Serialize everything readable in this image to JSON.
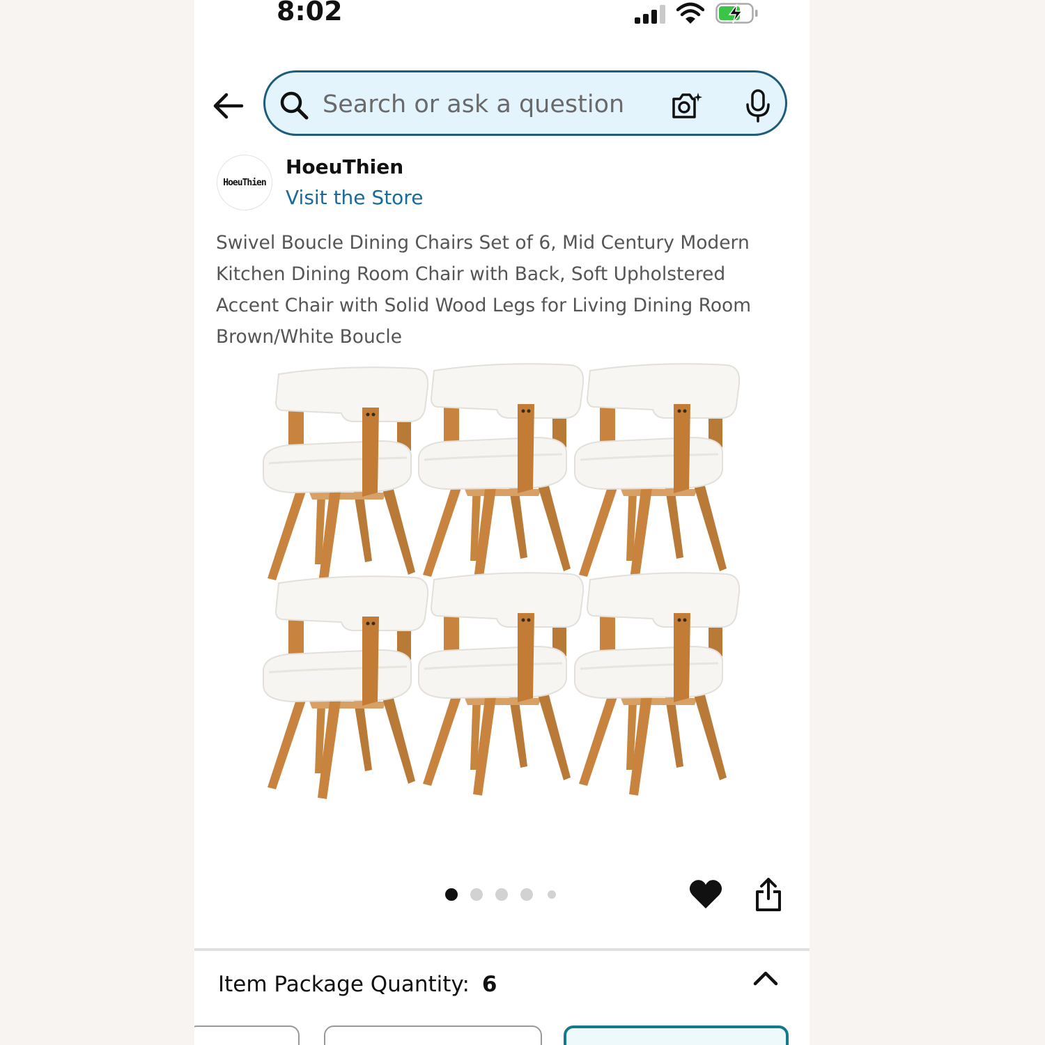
{
  "status_bar": {
    "time": "8:02"
  },
  "search": {
    "placeholder": "Search or ask a question"
  },
  "store": {
    "logo_text": "HoeuThien",
    "name": "HoeuThien",
    "link": "Visit the Store"
  },
  "product": {
    "title": "Swivel Boucle Dining Chairs Set of 6, Mid Century Modern Kitchen Dining Room Chair with Back, Soft Upholstered Accent Chair with Solid Wood Legs for Living Dining Room Brown/White Boucle",
    "image_count": 5,
    "current_image": 1
  },
  "quantity": {
    "label": "Item Package Quantity:",
    "value": "6"
  },
  "colors": {
    "accent": "#1f5c7a",
    "link": "#1a6a9a",
    "search_bg": "#e3f4fd",
    "selected_option": "#137a8e",
    "wood": "#c8843e",
    "boucle": "#f7f5f2"
  },
  "icons": [
    "back-arrow-icon",
    "search-icon",
    "camera-icon",
    "microphone-icon",
    "heart-icon",
    "share-icon",
    "chevron-up-icon"
  ]
}
